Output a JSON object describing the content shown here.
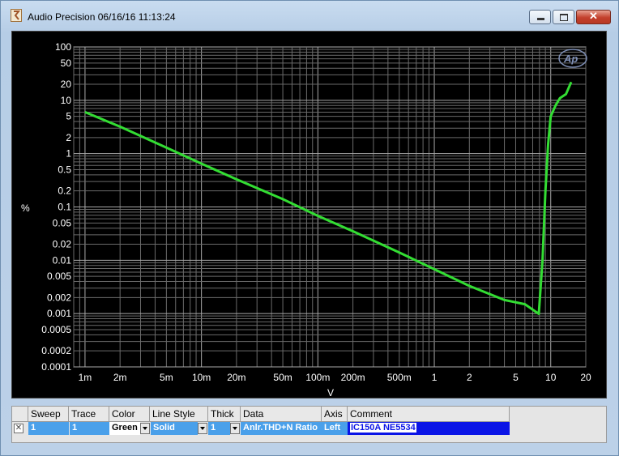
{
  "window": {
    "title": "Audio Precision  06/16/16 11:13:24"
  },
  "graph": {
    "y_unit": "%",
    "x_unit": "V",
    "logo": "Ap"
  },
  "chart_data": {
    "type": "line",
    "xscale": "log",
    "yscale": "log",
    "xlim": [
      0.0008,
      20
    ],
    "ylim": [
      0.0001,
      100
    ],
    "xlabel": "V",
    "ylabel": "%",
    "x_ticks": [
      "1m",
      "2m",
      "5m",
      "10m",
      "20m",
      "50m",
      "100m",
      "200m",
      "500m",
      "1",
      "2",
      "5",
      "10",
      "20"
    ],
    "x_tick_values": [
      0.001,
      0.002,
      0.005,
      0.01,
      0.02,
      0.05,
      0.1,
      0.2,
      0.5,
      1,
      2,
      5,
      10,
      20
    ],
    "y_ticks": [
      "100",
      "50",
      "20",
      "10",
      "5",
      "2",
      "1",
      "0.5",
      "0.2",
      "0.1",
      "0.05",
      "0.02",
      "0.01",
      "0.005",
      "0.002",
      "0.001",
      "0.0005",
      "0.0002",
      "0.0001"
    ],
    "y_tick_values": [
      100,
      50,
      20,
      10,
      5,
      2,
      1,
      0.5,
      0.2,
      0.1,
      0.05,
      0.02,
      0.01,
      0.005,
      0.002,
      0.001,
      0.0005,
      0.0002,
      0.0001
    ],
    "grid": true,
    "series": [
      {
        "color": "#33dd33",
        "x": [
          0.001,
          0.002,
          0.005,
          0.01,
          0.02,
          0.05,
          0.1,
          0.2,
          0.5,
          1,
          2,
          4,
          6,
          7.9,
          8.5,
          9.0,
          9.5,
          10,
          11,
          12,
          13.5,
          15
        ],
        "y": [
          6,
          3.2,
          1.3,
          0.65,
          0.33,
          0.14,
          0.068,
          0.035,
          0.014,
          0.0068,
          0.0033,
          0.0018,
          0.0015,
          0.00099,
          0.01,
          0.2,
          1.5,
          5,
          8,
          11,
          13,
          22
        ]
      }
    ]
  },
  "table": {
    "headers": {
      "sweep": "Sweep",
      "trace": "Trace",
      "color": "Color",
      "line_style": "Line Style",
      "thick": "Thick",
      "data": "Data",
      "axis": "Axis",
      "comment": "Comment"
    },
    "row": {
      "checkbox": "✕",
      "sweep": "1",
      "trace": "1",
      "color": "Green",
      "line_style": "Solid",
      "thick": "1",
      "data": "Anlr.THD+N Ratio",
      "axis": "Left",
      "comment": "IC150A  NE5534"
    }
  }
}
